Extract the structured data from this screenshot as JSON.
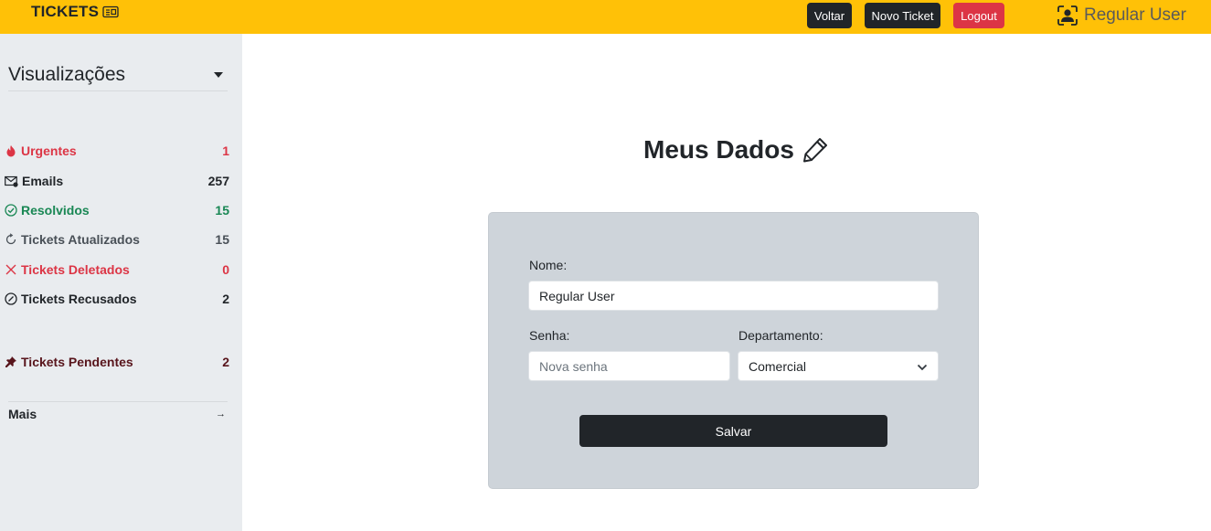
{
  "header": {
    "brand": "TICKETS",
    "brand_icon": "ticket-icon",
    "buttons": {
      "back": "Voltar",
      "new_ticket": "Novo Ticket",
      "logout": "Logout"
    },
    "user_name": "Regular User",
    "user_icon": "person-badge-icon",
    "colors": {
      "bar": "#ffc107",
      "dark_button": "#212529",
      "logout_button": "#dc3545"
    }
  },
  "sidebar": {
    "title": "Visualizações",
    "items": [
      {
        "label": "Urgentes",
        "count": "1",
        "icon": "fire-icon",
        "color": "#dc3545"
      },
      {
        "label": "Emails",
        "count": "257",
        "icon": "envelope-icon",
        "color": "#212529"
      },
      {
        "label": "Resolvidos",
        "count": "15",
        "icon": "check-circle-icon",
        "color": "#198754"
      },
      {
        "label": "Tickets Atualizados",
        "count": "15",
        "icon": "refresh-icon",
        "color": "#495057"
      },
      {
        "label": "Tickets Deletados",
        "count": "0",
        "icon": "x-icon",
        "color": "#dc3545"
      },
      {
        "label": "Tickets Recusados",
        "count": "2",
        "icon": "slash-circle-icon",
        "color": "#212529"
      },
      {
        "label": "Tickets Pendentes",
        "count": "2",
        "icon": "pin-icon",
        "color": "#58151c"
      }
    ],
    "more": {
      "label": "Mais",
      "icon": "arrow-right-icon"
    }
  },
  "main": {
    "title": "Meus Dados",
    "title_icon": "pencil-icon",
    "form": {
      "name_label": "Nome:",
      "name_value": "Regular User",
      "password_label": "Senha:",
      "password_placeholder": "Nova senha",
      "department_label": "Departamento:",
      "department_value": "Comercial",
      "save_label": "Salvar"
    }
  }
}
